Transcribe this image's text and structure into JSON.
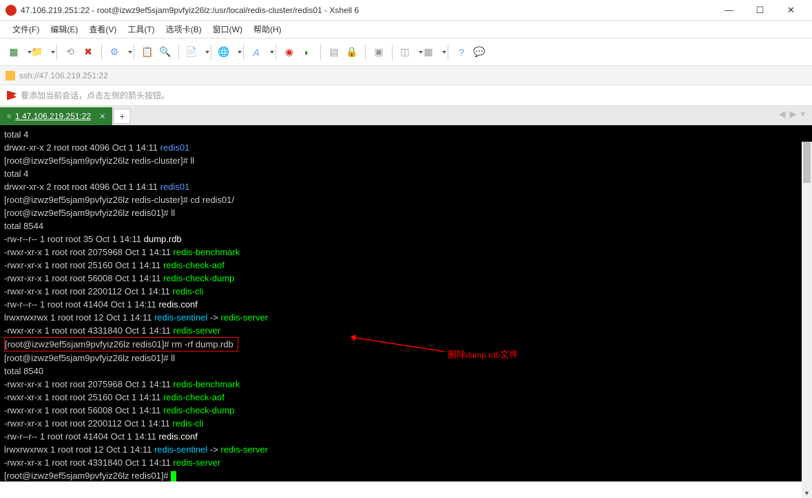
{
  "window": {
    "title": "47.106.219.251:22 - root@izwz9ef5sjam9pvfyiz26lz:/usr/local/redis-cluster/redis01 - Xshell 6"
  },
  "menu": {
    "file": "文件(F)",
    "edit": "编辑(E)",
    "view": "查看(V)",
    "tools": "工具(T)",
    "tabs": "选项卡(B)",
    "window": "窗口(W)",
    "help": "帮助(H)"
  },
  "address": {
    "url": "ssh://47.106.219.251:22"
  },
  "hint": {
    "text": "要添加当前会话，点击左侧的箭头按钮。"
  },
  "tabs": {
    "main": "1 47.106.219.251:22"
  },
  "annotation": {
    "text": "删除dump.rdb文件"
  },
  "terminal": {
    "prompt_user": "root@izwz9ef5sjam9pvfyiz26lz",
    "lines": [
      {
        "t": "plain",
        "text": "total 4"
      },
      {
        "t": "dir",
        "perms": "drwxr-xr-x 2 root root 4096 Oct  1 14:11 ",
        "name": "redis01"
      },
      {
        "t": "cmd",
        "path": "redis-cluster",
        "cmdtext": "ll"
      },
      {
        "t": "plain",
        "text": "total 4"
      },
      {
        "t": "dir",
        "perms": "drwxr-xr-x 2 root root 4096 Oct  1 14:11 ",
        "name": "redis01"
      },
      {
        "t": "cmd",
        "path": "redis-cluster",
        "cmdtext": "cd redis01/"
      },
      {
        "t": "cmd",
        "path": "redis01",
        "cmdtext": "ll"
      },
      {
        "t": "plain",
        "text": "total 8544"
      },
      {
        "t": "file",
        "perms": "-rw-r--r-- 1 root root      35 Oct  1 14:11 ",
        "name": "dump.rdb",
        "color": "w"
      },
      {
        "t": "file",
        "perms": "-rwxr-xr-x 1 root root 2075968 Oct  1 14:11 ",
        "name": "redis-benchmark",
        "color": "g"
      },
      {
        "t": "file",
        "perms": "-rwxr-xr-x 1 root root   25160 Oct  1 14:11 ",
        "name": "redis-check-aof",
        "color": "g"
      },
      {
        "t": "file",
        "perms": "-rwxr-xr-x 1 root root   56008 Oct  1 14:11 ",
        "name": "redis-check-dump",
        "color": "g"
      },
      {
        "t": "file",
        "perms": "-rwxr-xr-x 1 root root 2200112 Oct  1 14:11 ",
        "name": "redis-cli",
        "color": "g"
      },
      {
        "t": "file",
        "perms": "-rw-r--r-- 1 root root   41404 Oct  1 14:11 ",
        "name": "redis.conf",
        "color": "w"
      },
      {
        "t": "link",
        "perms": "lrwxrwxrwx 1 root root      12 Oct  1 14:11 ",
        "name": "redis-sentinel",
        "target": "redis-server"
      },
      {
        "t": "file",
        "perms": "-rwxr-xr-x 1 root root 4331840 Oct  1 14:11 ",
        "name": "redis-server",
        "color": "g"
      },
      {
        "t": "cmdbox",
        "path": "redis01",
        "cmdtext": "rm -rf dump.rdb"
      },
      {
        "t": "cmd",
        "path": "redis01",
        "cmdtext": "ll"
      },
      {
        "t": "plain",
        "text": "total 8540"
      },
      {
        "t": "file",
        "perms": "-rwxr-xr-x 1 root root 2075968 Oct  1 14:11 ",
        "name": "redis-benchmark",
        "color": "g"
      },
      {
        "t": "file",
        "perms": "-rwxr-xr-x 1 root root   25160 Oct  1 14:11 ",
        "name": "redis-check-aof",
        "color": "g"
      },
      {
        "t": "file",
        "perms": "-rwxr-xr-x 1 root root   56008 Oct  1 14:11 ",
        "name": "redis-check-dump",
        "color": "g"
      },
      {
        "t": "file",
        "perms": "-rwxr-xr-x 1 root root 2200112 Oct  1 14:11 ",
        "name": "redis-cli",
        "color": "g"
      },
      {
        "t": "file",
        "perms": "-rw-r--r-- 1 root root   41404 Oct  1 14:11 ",
        "name": "redis.conf",
        "color": "w"
      },
      {
        "t": "link",
        "perms": "lrwxrwxrwx 1 root root      12 Oct  1 14:11 ",
        "name": "redis-sentinel",
        "target": "redis-server"
      },
      {
        "t": "file",
        "perms": "-rwxr-xr-x 1 root root 4331840 Oct  1 14:11 ",
        "name": "redis-server",
        "color": "g"
      },
      {
        "t": "cmdcursor",
        "path": "redis01"
      }
    ]
  }
}
